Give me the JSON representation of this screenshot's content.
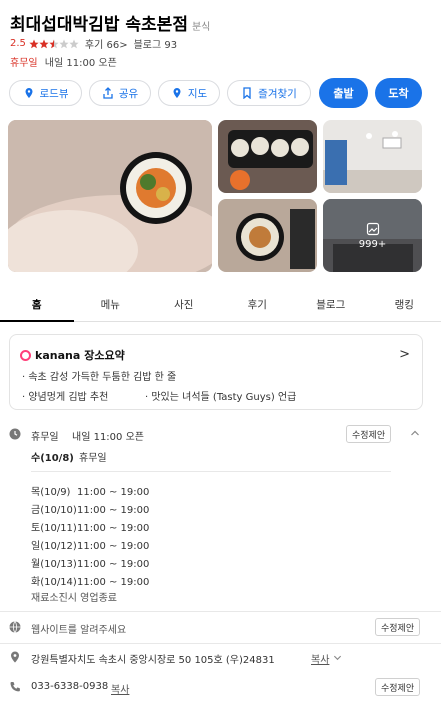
{
  "header": {
    "title": "최대섭대박김밥 속초본점",
    "category": "분식",
    "rating": "2.5",
    "stars_filled_fraction": 0.5,
    "reviews": "후기 66",
    "reviews_chevron": ">",
    "blog": "블로그 93",
    "status": "휴무일",
    "status_detail": "내일 11:00 오픈"
  },
  "actions": {
    "roadview": "로드뷰",
    "share": "공유",
    "map": "지도",
    "favorite": "즐겨찾기",
    "depart": "출발",
    "arrive": "도착"
  },
  "photos": {
    "more_label": "999+"
  },
  "tabs": [
    "홈",
    "메뉴",
    "사진",
    "후기",
    "블로그",
    "랭킹"
  ],
  "summary": {
    "brand": "kanana",
    "title": "장소요약",
    "chevron": ">",
    "bullets": [
      "· 속초 감성 가득한 두툼한 김밥 한 줄",
      "· 양념멍게 김밥 추천",
      "· 맛있는 녀석들 (Tasty Guys) 언급"
    ]
  },
  "hours": {
    "status": "휴무일",
    "status_detail": "내일 11:00 오픈",
    "edit": "수정제안",
    "today_label": "수(10/8)",
    "today_status": "휴무일",
    "rows": [
      {
        "day": "목(10/9)",
        "time": "11:00 ~ 19:00"
      },
      {
        "day": "금(10/10)",
        "time": "11:00 ~ 19:00"
      },
      {
        "day": "토(10/11)",
        "time": "11:00 ~ 19:00"
      },
      {
        "day": "일(10/12)",
        "time": "11:00 ~ 19:00"
      },
      {
        "day": "월(10/13)",
        "time": "11:00 ~ 19:00"
      },
      {
        "day": "화(10/14)",
        "time": "11:00 ~ 19:00"
      }
    ],
    "note": "재료소진시 영업종료"
  },
  "website": {
    "text": "웹사이트를 알려주세요",
    "edit": "수정제안"
  },
  "address": {
    "text": "강원특별자치도 속초시 중앙시장로 50 105호 (우)24831",
    "copy": "복사"
  },
  "phone": {
    "text": "033-6338-0938",
    "copy": "복사",
    "edit": "수정제안"
  },
  "colors": {
    "accent": "#1a73e8",
    "red": "#d93025",
    "kanana": "#ff3f79"
  }
}
